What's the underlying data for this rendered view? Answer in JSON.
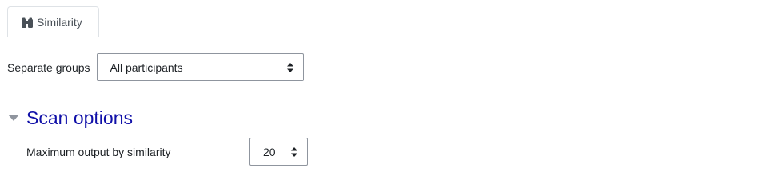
{
  "tabs": [
    {
      "label": "Similarity",
      "icon": "binoculars-icon",
      "active": true
    }
  ],
  "groups": {
    "label": "Separate groups",
    "selected": "All participants"
  },
  "scan_options": {
    "title": "Scan options",
    "expanded": true,
    "max_output": {
      "label": "Maximum output by similarity",
      "selected": "20"
    }
  },
  "colors": {
    "section_title": "#1010a8",
    "border": "#8f959e",
    "tab_border": "#dee2e6"
  }
}
